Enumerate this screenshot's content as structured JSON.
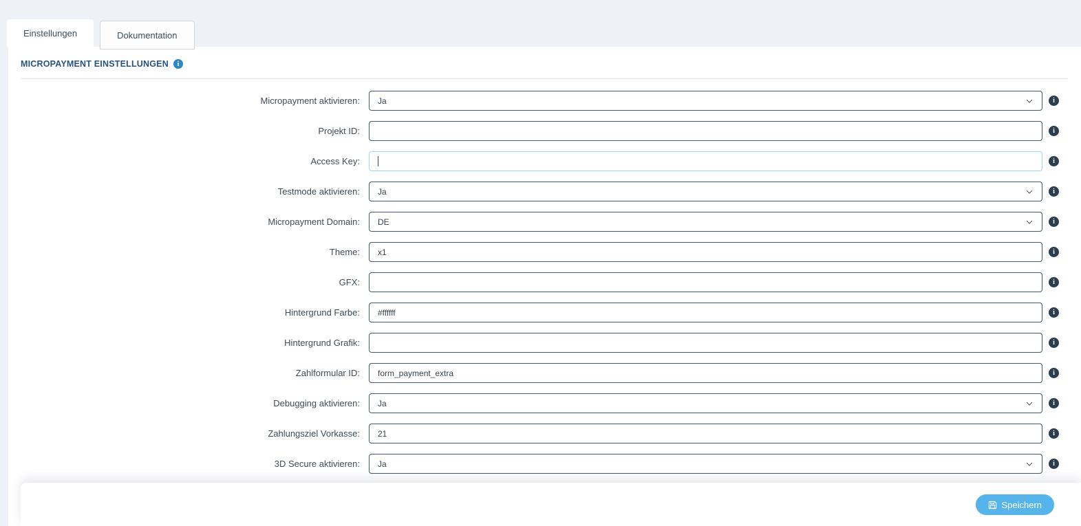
{
  "tabs": [
    {
      "label": "Einstellungen",
      "active": true
    },
    {
      "label": "Dokumentation",
      "active": false
    }
  ],
  "section": {
    "title": "MICROPAYMENT EINSTELLUNGEN",
    "info_icon": "info-icon"
  },
  "form": {
    "fields": [
      {
        "label": "Micropayment aktivieren:",
        "type": "select",
        "value": "Ja",
        "focused": false,
        "info_icon": "info-icon"
      },
      {
        "label": "Projekt ID:",
        "type": "text",
        "value": "",
        "focused": false,
        "info_icon": "info-icon"
      },
      {
        "label": "Access Key:",
        "type": "text",
        "value": "",
        "focused": true,
        "info_icon": "info-icon"
      },
      {
        "label": "Testmode aktivieren:",
        "type": "select",
        "value": "Ja",
        "focused": false,
        "info_icon": "info-icon"
      },
      {
        "label": "Micropayment Domain:",
        "type": "select",
        "value": "DE",
        "focused": false,
        "info_icon": "info-icon"
      },
      {
        "label": "Theme:",
        "type": "text",
        "value": "x1",
        "focused": false,
        "info_icon": "info-icon"
      },
      {
        "label": "GFX:",
        "type": "text",
        "value": "",
        "focused": false,
        "info_icon": "info-icon"
      },
      {
        "label": "Hintergrund Farbe:",
        "type": "text",
        "value": "#ffffff",
        "focused": false,
        "info_icon": "info-icon"
      },
      {
        "label": "Hintergrund Grafik:",
        "type": "text",
        "value": "",
        "focused": false,
        "info_icon": "info-icon"
      },
      {
        "label": "Zahlformular ID:",
        "type": "text",
        "value": "form_payment_extra",
        "focused": false,
        "info_icon": "info-icon"
      },
      {
        "label": "Debugging aktivieren:",
        "type": "select",
        "value": "Ja",
        "focused": false,
        "info_icon": "info-icon"
      },
      {
        "label": "Zahlungsziel Vorkasse:",
        "type": "text",
        "value": "21",
        "focused": false,
        "info_icon": "info-icon"
      },
      {
        "label": "3D Secure aktivieren:",
        "type": "select",
        "value": "Ja",
        "focused": false,
        "info_icon": "info-icon"
      }
    ]
  },
  "footer": {
    "save_label": "Speichern",
    "save_icon": "save-icon"
  },
  "colors": {
    "page_background": "#eef1f6",
    "panel_background": "#ffffff",
    "heading_text": "#27547e",
    "heading_info_icon": "#2e86c4",
    "field_info_icon": "#2b3d4f",
    "input_border": "#43586c",
    "input_border_focused": "#a0d5f7",
    "save_button": "#55b5ea"
  }
}
